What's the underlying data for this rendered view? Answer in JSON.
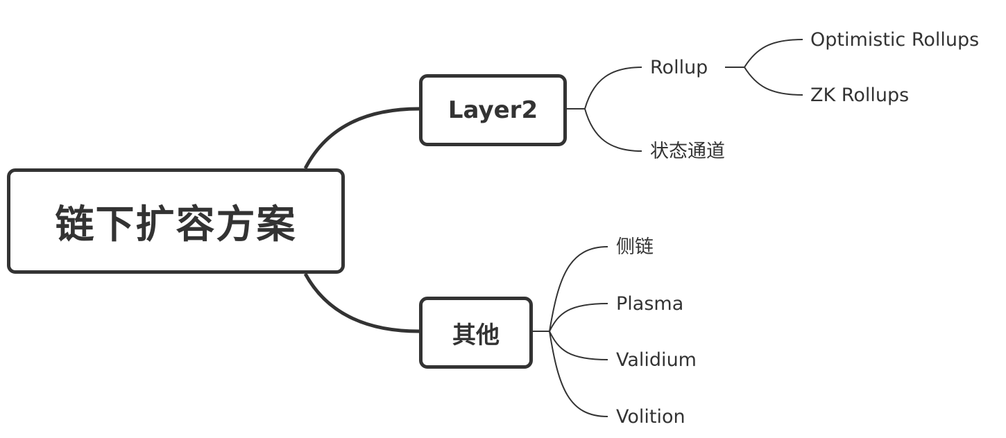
{
  "diagram": {
    "root": {
      "label": "链下扩容方案"
    },
    "branches": [
      {
        "label": "Layer2",
        "children": [
          {
            "label": "Rollup",
            "children": [
              {
                "label": "Optimistic Rollups"
              },
              {
                "label": "ZK Rollups"
              }
            ]
          },
          {
            "label": "状态通道"
          }
        ]
      },
      {
        "label": "其他",
        "children": [
          {
            "label": "侧链"
          },
          {
            "label": "Plasma"
          },
          {
            "label": "Validium"
          },
          {
            "label": "Volition"
          }
        ]
      }
    ]
  },
  "colors": {
    "stroke": "#333333",
    "background": "#ffffff"
  }
}
